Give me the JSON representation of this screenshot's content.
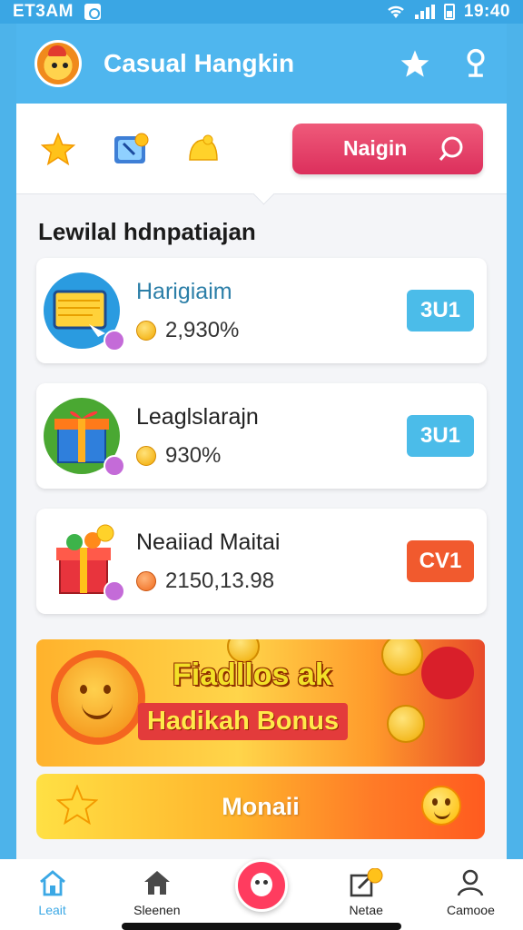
{
  "status_bar": {
    "time_left": "ET3AM",
    "time_right": "19:40"
  },
  "header": {
    "title": "Casual Hangkin",
    "star_icon": "star-icon",
    "location_icon": "location-pin-icon"
  },
  "toolbar": {
    "icons": [
      "star-icon",
      "video-call-icon",
      "bell-icon"
    ],
    "search_label": "Naigin"
  },
  "section": {
    "title": "Lewilal hdnpatiajan"
  },
  "cards": [
    {
      "title": "Harigiaim",
      "value": "2,930%",
      "badge": "3U1",
      "badge_color": "#4bbce9"
    },
    {
      "title": "Leaglslarajn",
      "value": "930%",
      "badge": "3U1",
      "badge_color": "#4bbce9"
    },
    {
      "title": "Neaiiad Maitai",
      "value": "2150,13.98",
      "badge": "CV1",
      "badge_color": "#f15a2e"
    }
  ],
  "banner": {
    "title": "Fiadllos ak",
    "subtitle": "Hadikah Bonus"
  },
  "cta": {
    "label": "Monaii"
  },
  "bottom_nav": [
    {
      "label": "Leait",
      "icon": "home-icon",
      "active": true
    },
    {
      "label": "Sleenen",
      "icon": "house-icon",
      "active": false
    },
    {
      "label": "",
      "icon": "mascot-icon",
      "active": false
    },
    {
      "label": "Netae",
      "icon": "edit-icon",
      "active": false
    },
    {
      "label": "Camooe",
      "icon": "profile-icon",
      "active": false
    }
  ],
  "colors": {
    "accent": "#4fb6ee",
    "primary_button": "#dc2f5c",
    "cta": "#ff7b27"
  }
}
